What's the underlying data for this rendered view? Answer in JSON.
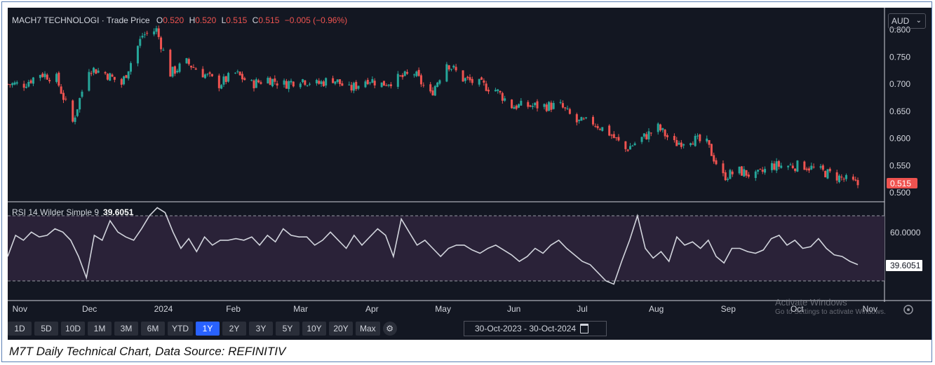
{
  "caption": "M7T Daily Technical Chart, Data Source: REFINITIV",
  "legend": {
    "symbol": "MACH7 TECHNOLOGI",
    "series": "Trade Price",
    "o_label": "O",
    "o_value": "0.520",
    "h_label": "H",
    "h_value": "0.520",
    "l_label": "L",
    "l_value": "0.515",
    "c_label": "C",
    "c_value": "0.515",
    "change": "−0.005 (−0.96%)"
  },
  "currency": "AUD",
  "last_price_label": "0.515",
  "rsi": {
    "title": "RSI 14 Wilder Simple 9",
    "value": "39.6051",
    "level_label": "60.0000",
    "last_label": "39.6051"
  },
  "time_axis": [
    "Nov",
    "Dec",
    "2024",
    "Feb",
    "Mar",
    "Apr",
    "May",
    "Jun",
    "Jul",
    "Aug",
    "Sep",
    "Oct",
    "Nov"
  ],
  "timeframes": [
    "1D",
    "5D",
    "10D",
    "1M",
    "3M",
    "6M",
    "YTD",
    "1Y",
    "2Y",
    "3Y",
    "5Y",
    "10Y",
    "20Y",
    "Max"
  ],
  "active_timeframe": "1Y",
  "date_range": "30-Oct-2023 - 30-Oct-2024",
  "watermark": {
    "line1": "Activate Windows",
    "line2": "Go to Settings to activate Windows."
  },
  "colors": {
    "up": "#26a69a",
    "down": "#ef5350",
    "rsi_line": "#d1d4dc",
    "rsi_band": "#2a2238",
    "background": "#131722",
    "accent": "#2962ff"
  },
  "chart_data": [
    {
      "type": "candlestick",
      "title": "MACH7 TECHNOLOGI · Trade Price",
      "y_ticks": [
        0.5,
        0.55,
        0.6,
        0.65,
        0.7,
        0.75,
        0.8
      ],
      "ylim": [
        0.49,
        0.815
      ],
      "x_labels": [
        "Nov",
        "Dec",
        "2024",
        "Feb",
        "Mar",
        "Apr",
        "May",
        "Jun",
        "Jul",
        "Aug",
        "Sep",
        "Oct",
        "Nov"
      ],
      "x_range": [
        "30-Oct-2023",
        "30-Oct-2024"
      ],
      "close_trend": [
        [
          "2023-10-30",
          0.7
        ],
        [
          "2023-11-06",
          0.7
        ],
        [
          "2023-11-13",
          0.72
        ],
        [
          "2023-11-20",
          0.71
        ],
        [
          "2023-11-27",
          0.63
        ],
        [
          "2023-12-04",
          0.73
        ],
        [
          "2023-12-11",
          0.72
        ],
        [
          "2023-12-18",
          0.7
        ],
        [
          "2023-12-27",
          0.79
        ],
        [
          "2024-01-02",
          0.8
        ],
        [
          "2024-01-08",
          0.72
        ],
        [
          "2024-01-15",
          0.74
        ],
        [
          "2024-01-22",
          0.72
        ],
        [
          "2024-01-29",
          0.7
        ],
        [
          "2024-02-05",
          0.72
        ],
        [
          "2024-02-12",
          0.7
        ],
        [
          "2024-02-19",
          0.71
        ],
        [
          "2024-02-26",
          0.7
        ],
        [
          "2024-03-04",
          0.71
        ],
        [
          "2024-03-11",
          0.7
        ],
        [
          "2024-03-18",
          0.71
        ],
        [
          "2024-03-25",
          0.69
        ],
        [
          "2024-04-02",
          0.71
        ],
        [
          "2024-04-08",
          0.7
        ],
        [
          "2024-04-15",
          0.71
        ],
        [
          "2024-04-22",
          0.72
        ],
        [
          "2024-04-29",
          0.68
        ],
        [
          "2024-05-06",
          0.74
        ],
        [
          "2024-05-13",
          0.71
        ],
        [
          "2024-05-20",
          0.7
        ],
        [
          "2024-05-27",
          0.69
        ],
        [
          "2024-06-03",
          0.66
        ],
        [
          "2024-06-10",
          0.66
        ],
        [
          "2024-06-17",
          0.66
        ],
        [
          "2024-06-24",
          0.66
        ],
        [
          "2024-07-01",
          0.63
        ],
        [
          "2024-07-08",
          0.63
        ],
        [
          "2024-07-15",
          0.61
        ],
        [
          "2024-07-22",
          0.58
        ],
        [
          "2024-07-29",
          0.6
        ],
        [
          "2024-08-05",
          0.62
        ],
        [
          "2024-08-12",
          0.59
        ],
        [
          "2024-08-19",
          0.6
        ],
        [
          "2024-08-26",
          0.59
        ],
        [
          "2024-09-02",
          0.53
        ],
        [
          "2024-09-09",
          0.54
        ],
        [
          "2024-09-16",
          0.53
        ],
        [
          "2024-09-23",
          0.55
        ],
        [
          "2024-09-30",
          0.55
        ],
        [
          "2024-10-07",
          0.55
        ],
        [
          "2024-10-14",
          0.54
        ],
        [
          "2024-10-21",
          0.53
        ],
        [
          "2024-10-30",
          0.515
        ]
      ],
      "last": {
        "open": 0.52,
        "high": 0.52,
        "low": 0.515,
        "close": 0.515,
        "change": -0.005,
        "change_pct": -0.96
      }
    },
    {
      "type": "line",
      "title": "RSI 14 Wilder Simple 9",
      "levels": [
        30,
        70
      ],
      "y_ticks": [
        60
      ],
      "ylim": [
        20,
        80
      ],
      "series": [
        {
          "name": "RSI 14",
          "values": [
            45,
            58,
            55,
            60,
            57,
            58,
            62,
            60,
            55,
            45,
            32,
            58,
            55,
            67,
            60,
            57,
            55,
            62,
            70,
            75,
            72,
            60,
            50,
            56,
            48,
            57,
            52,
            55,
            55,
            56,
            55,
            57,
            52,
            58,
            54,
            62,
            58,
            57,
            57,
            52,
            55,
            60,
            55,
            50,
            58,
            52,
            57,
            62,
            58,
            45,
            68,
            60,
            52,
            55,
            50,
            45,
            50,
            52,
            52,
            49,
            47,
            50,
            52,
            49,
            46,
            42,
            45,
            50,
            47,
            52,
            55,
            50,
            46,
            42,
            40,
            35,
            30,
            28,
            42,
            55,
            70,
            50,
            44,
            48,
            42,
            57,
            52,
            54,
            50,
            55,
            45,
            41,
            50,
            50,
            48,
            47,
            49,
            56,
            58,
            52,
            55,
            50,
            51,
            56,
            50,
            46,
            45,
            42,
            40
          ]
        }
      ],
      "last": 39.6051
    }
  ]
}
